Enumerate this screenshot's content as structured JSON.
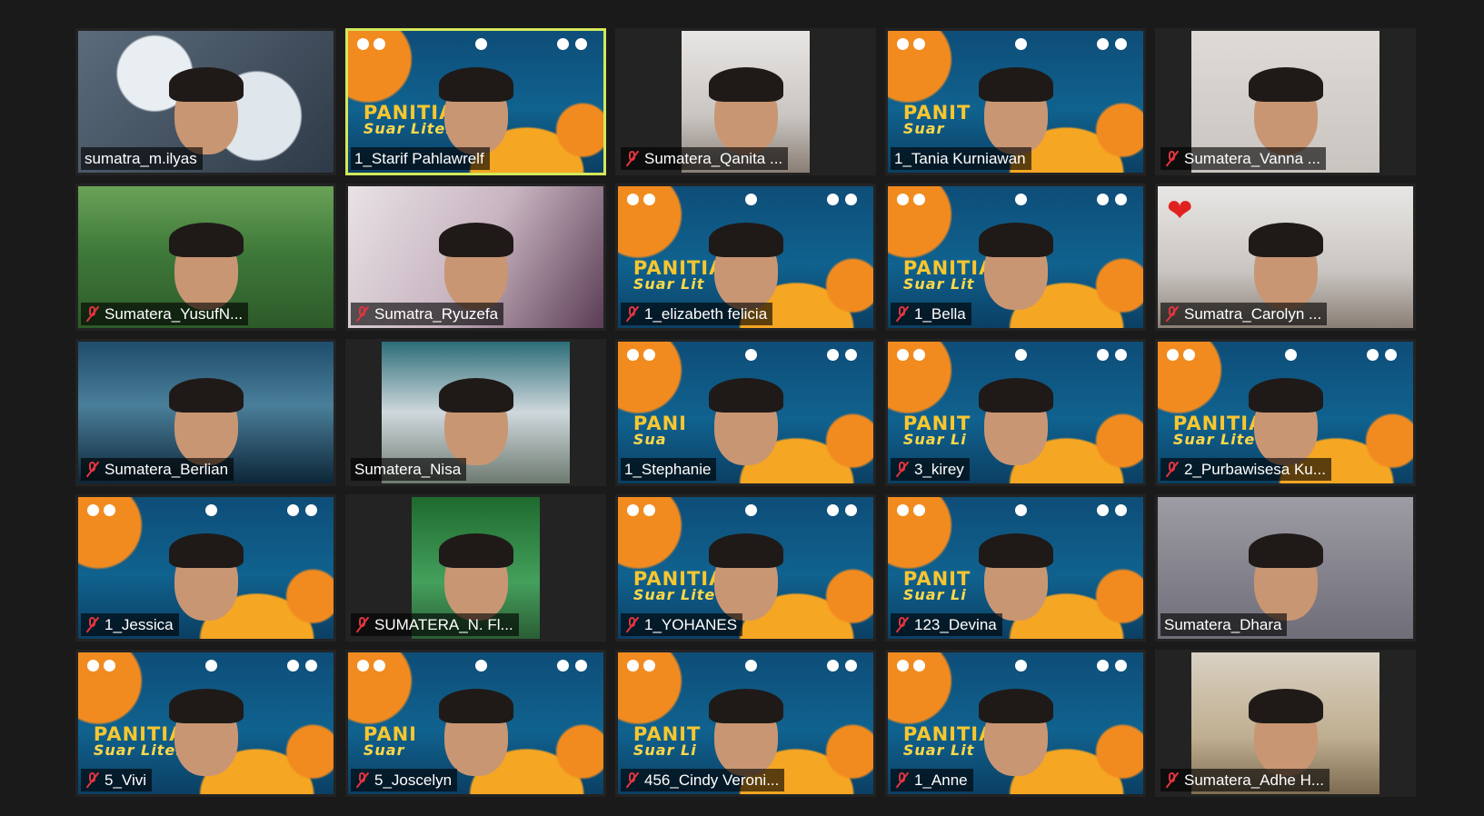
{
  "participants": [
    {
      "name": "sumatra_m.ilyas",
      "muted": false,
      "bg": "cloud",
      "width": "full"
    },
    {
      "name": "1_Starif Pahlawrelf",
      "muted": false,
      "bg": "banner",
      "width": "full",
      "active": true,
      "banner": "PANITIA",
      "banner_sub": "Suar Liter"
    },
    {
      "name": "Sumatera_Qanita ...",
      "muted": true,
      "bg": "room",
      "width": "narrow"
    },
    {
      "name": "1_Tania Kurniawan",
      "muted": false,
      "bg": "banner",
      "width": "full",
      "banner": "PANIT",
      "banner_sub": "Suar"
    },
    {
      "name": "Sumatera_Vanna ...",
      "muted": true,
      "bg": "pink",
      "width": "mid"
    },
    {
      "name": "Sumatera_YusufN...",
      "muted": true,
      "bg": "forest",
      "width": "full"
    },
    {
      "name": "Sumatra_Ryuzefa",
      "muted": true,
      "bg": "anime",
      "width": "full"
    },
    {
      "name": "1_elizabeth felicia",
      "muted": true,
      "bg": "banner",
      "width": "full",
      "banner": "PANITIA",
      "banner_sub": "Suar Lit"
    },
    {
      "name": "1_Bella",
      "muted": true,
      "bg": "banner",
      "width": "full",
      "banner": "PANITIA",
      "banner_sub": "Suar Lit"
    },
    {
      "name": "Sumatra_Carolyn ...",
      "muted": true,
      "bg": "room",
      "width": "full",
      "reaction": true
    },
    {
      "name": "Sumatera_Berlian",
      "muted": true,
      "bg": "night",
      "width": "full"
    },
    {
      "name": "Sumatera_Nisa",
      "muted": false,
      "bg": "window",
      "width": "mid"
    },
    {
      "name": "1_Stephanie",
      "muted": false,
      "bg": "banner",
      "width": "full",
      "banner": "PANI",
      "banner_sub": "Sua"
    },
    {
      "name": "3_kirey",
      "muted": true,
      "bg": "banner",
      "width": "full",
      "banner": "PANIT",
      "banner_sub": "Suar Li"
    },
    {
      "name": "2_Purbawisesa Ku...",
      "muted": true,
      "bg": "banner",
      "width": "full",
      "banner": "PANITIA",
      "banner_sub": "Suar Lite"
    },
    {
      "name": "1_Jessica",
      "muted": true,
      "bg": "banner",
      "width": "full",
      "banner": "",
      "banner_sub": ""
    },
    {
      "name": "SUMATERA_N. Fl...",
      "muted": true,
      "bg": "green",
      "width": "narrow"
    },
    {
      "name": "1_YOHANES",
      "muted": true,
      "bg": "banner",
      "width": "full",
      "banner": "PANITIA",
      "banner_sub": "Suar Lite"
    },
    {
      "name": "123_Devina",
      "muted": true,
      "bg": "banner",
      "width": "full",
      "banner": "PANIT",
      "banner_sub": "Suar Li"
    },
    {
      "name": "Sumatera_Dhara",
      "muted": false,
      "bg": "dhara",
      "width": "full"
    },
    {
      "name": "5_Vivi",
      "muted": true,
      "bg": "banner",
      "width": "full",
      "banner": "PANITIA",
      "banner_sub": "Suar Literasi"
    },
    {
      "name": "5_Joscelyn",
      "muted": true,
      "bg": "banner",
      "width": "full",
      "banner": "PANI",
      "banner_sub": "Suar"
    },
    {
      "name": "456_Cindy Veroni...",
      "muted": true,
      "bg": "banner",
      "width": "full",
      "banner": "PANIT",
      "banner_sub": "Suar Li"
    },
    {
      "name": "1_Anne",
      "muted": true,
      "bg": "banner",
      "width": "full",
      "banner": "PANITIA",
      "banner_sub": "Suar Lit"
    },
    {
      "name": "Sumatera_Adhe H...",
      "muted": true,
      "bg": "stair",
      "width": "mid"
    }
  ],
  "reaction_icon": "heart-icon",
  "muted_icon": "muted-microphone-icon",
  "colors": {
    "active_border": "#d3e85a",
    "muted_red": "#e4343f",
    "background": "#1a1a1a"
  }
}
